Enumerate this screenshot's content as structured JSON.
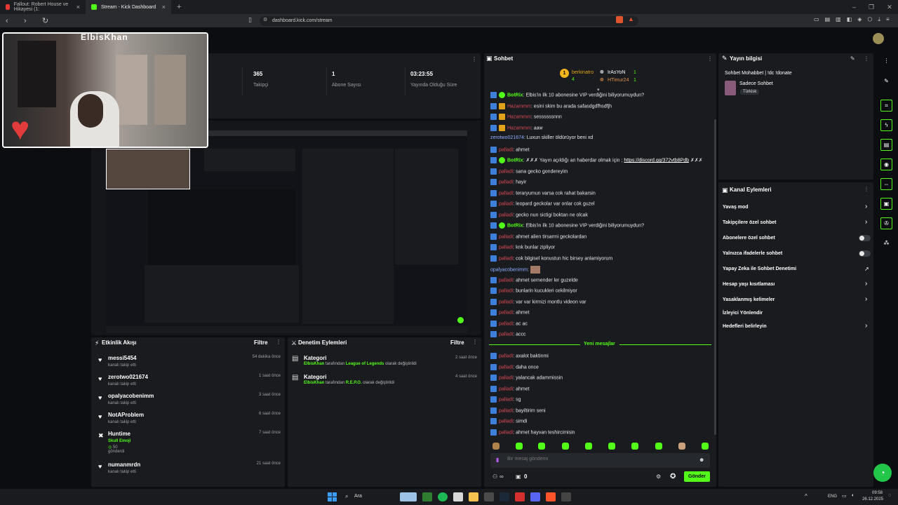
{
  "browser": {
    "tabs": [
      {
        "label": "Fallout: Robert House ve Hikayesi (1:"
      },
      {
        "label": "Stream - Kick Dashboard"
      }
    ],
    "url": "dashboard.kick.com/stream"
  },
  "stats": [
    {
      "value": "365",
      "label": "Takipçi"
    },
    {
      "value": "1",
      "label": "Abone Sayısı"
    },
    {
      "value": "03:23:55",
      "label": "Yayında Olduğu Süre"
    }
  ],
  "webcam": {
    "overlay_name": "ElbisKhan"
  },
  "activity": {
    "title": "Etkinlik Akışı",
    "filter": "Filtre",
    "items": [
      {
        "name": "messi5454",
        "sub": "kanalı takip etti",
        "time": "54 dakika önce"
      },
      {
        "name": "zerotwo021674",
        "sub": "kanalı takip etti",
        "time": "1 saat önce"
      },
      {
        "name": "opalyacobenimm",
        "sub": "kanalı takip etti",
        "time": "3 saat önce"
      },
      {
        "name": "NotAProblem",
        "sub": "kanalı takip etti",
        "time": "6 saat önce"
      },
      {
        "name": "Huntime",
        "sub": "Skull Emoji",
        "extra": "50",
        "extra2": "gönderdi",
        "time": "7 saat önce"
      },
      {
        "name": "numanmrdn",
        "sub": "kanalı takip etti",
        "time": "21 saat önce"
      }
    ]
  },
  "moderation": {
    "title": "Denetim Eylemleri",
    "filter": "Filtre",
    "items": [
      {
        "title": "Kategori",
        "actor": "ElbisKhan",
        "mid": "tarafından",
        "target": "League of Legends",
        "suffix": "olarak değiştirildi",
        "time": "2 saat önce"
      },
      {
        "title": "Kategori",
        "actor": "ElbisKhan",
        "mid": "tarafından",
        "target": "R.E.P.O.",
        "suffix": "olarak değiştirildi",
        "time": "4 saat önce"
      }
    ]
  },
  "chat": {
    "title": "Sohbet",
    "top_users": [
      {
        "name": "berkinatro",
        "count": "4"
      },
      {
        "name": "IrAsYoN",
        "count": "1"
      },
      {
        "name": "HTimur24",
        "count": "1"
      }
    ],
    "messages": [
      {
        "user": "BotRix",
        "text": "Elbis'in ilk 10 abonesine VIP verdiğini biliyorumuydun?"
      },
      {
        "user": "Hazammm",
        "text": "esini skim bu arada safasdgdfhsdfjh"
      },
      {
        "user": "Hazammm",
        "text": "sessssssnnn"
      },
      {
        "user": "Hazammm",
        "text": "aaw"
      },
      {
        "user": "zerotwo021674",
        "text": "Luxun skiller öldürüyor beni xd"
      },
      {
        "user": "palladi",
        "text": "ahmet"
      },
      {
        "user": "BotRix",
        "text": "✗✗✗ Yayın açıldığı an haberdar olmak için ;",
        "link": "https://discord.gg/372vtb8Pdb",
        "tail": "✗✗✗"
      },
      {
        "user": "palladi",
        "text": "sana gecko gondereyim"
      },
      {
        "user": "palladi",
        "text": "hayir"
      },
      {
        "user": "palladi",
        "text": "teraryumun varsa cok rahat bakarsin"
      },
      {
        "user": "palladi",
        "text": "leopard geckolar var onlar cok guzel"
      },
      {
        "user": "palladi",
        "text": "gecko nun sictigi boktan ne olcak"
      },
      {
        "user": "BotRix",
        "text": "Elbis'in ilk 10 abonesine VIP verdiğini biliyorumuydun?"
      },
      {
        "user": "palladi",
        "text": "ahmet alien tirsarmi geckolardan"
      },
      {
        "user": "palladi",
        "text": "knk bunlar zipliyor"
      },
      {
        "user": "palladi",
        "text": "cok bilgisel konustun hic birsey anlamiyorum"
      },
      {
        "user": "opalyacobenimm",
        "text": ""
      },
      {
        "user": "palladi",
        "text": "ahmet semender ler guzelde"
      },
      {
        "user": "palladi",
        "text": "bunlarin kucukleri cekilmiyor"
      },
      {
        "user": "palladi",
        "text": "var var kirmizi montlu videon var"
      },
      {
        "user": "palladi",
        "text": "ahmet"
      },
      {
        "user": "palladi",
        "text": "ac ac"
      },
      {
        "user": "palladi",
        "text": "accc"
      }
    ],
    "new_messages_label": "Yeni mesajlar",
    "new_messages": [
      {
        "user": "palladi",
        "text": "axalot baktinmi"
      },
      {
        "user": "palladi",
        "text": "daha once"
      },
      {
        "user": "palladi",
        "text": "yalancak adammissin"
      },
      {
        "user": "palladi",
        "text": "ahmet"
      },
      {
        "user": "palladi",
        "text": "sg"
      },
      {
        "user": "palladi",
        "text": "bayiltirim seni"
      },
      {
        "user": "palladi",
        "text": "simdi"
      },
      {
        "user": "palladi",
        "text": "ahmet hayvan teshircimisin"
      }
    ],
    "input_placeholder": "Bir mesaj gönderin",
    "send_label": "Gönder",
    "viewers": "∞",
    "gift_count": "0"
  },
  "stream_info": {
    "title": "Yayın bilgisi",
    "stream_title": "Sohbet Mohabbet | !dc !donate",
    "category": "Sadece Sohbet",
    "tag": "Türkisk"
  },
  "channel_actions": {
    "title": "Kanal Eylemleri",
    "items": [
      {
        "label": "Yavaş mod",
        "control": "chevron"
      },
      {
        "label": "Takipçilere özel sohbet",
        "control": "chevron"
      },
      {
        "label": "Abonelere özel sohbet",
        "control": "toggle"
      },
      {
        "label": "Yalnızca ifadelerle sohbet",
        "control": "toggle"
      },
      {
        "label": "Yapay Zeka ile Sohbet Denetimi",
        "control": "external"
      },
      {
        "label": "Hesap yaşı kısıtlaması",
        "control": "chevron"
      },
      {
        "label": "Yasaklanmış kelimeler",
        "control": "chevron"
      },
      {
        "label": "İzleyici Yönlendir",
        "control": "none"
      },
      {
        "label": "Hedefleri belirleyin",
        "control": "chevron"
      }
    ]
  },
  "taskbar": {
    "search": "Ara",
    "lang": "ENG",
    "time": "09:58",
    "date": "26.12.2025"
  },
  "colors": {
    "accent": "#53fc18",
    "panel": "#191b1f",
    "bg": "#0b0d10"
  }
}
